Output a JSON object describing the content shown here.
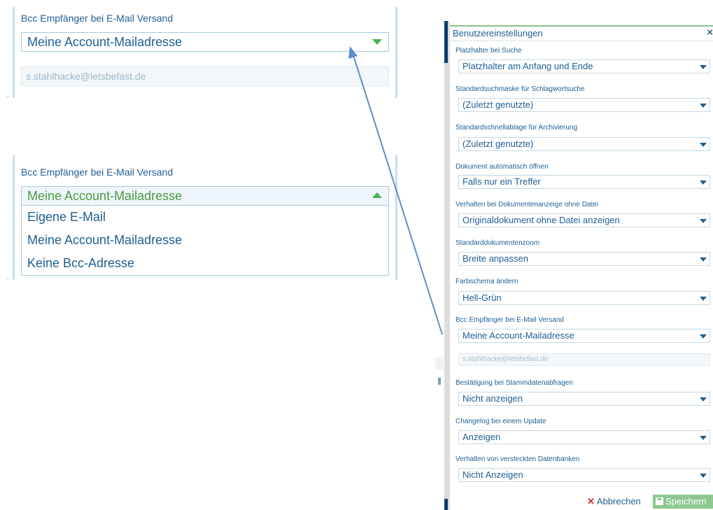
{
  "zoom_closed": {
    "label": "Bcc Empfänger bei E-Mail Versand",
    "selected": "Meine Account-Mailadresse",
    "email": "s.stahlhacke@letsbefast.de"
  },
  "zoom_open": {
    "label": "Bcc Empfänger bei E-Mail Versand",
    "selected": "Meine Account-Mailadresse",
    "options": [
      "Eigene E-Mail",
      "Meine Account-Mailadresse",
      "Keine Bcc-Adresse"
    ]
  },
  "dialog": {
    "title": "Benutzereinstellungen",
    "close_symbol": "×",
    "fields": [
      {
        "label": "Platzhalter bei Suche",
        "value": "Platzhalter am Anfang und Ende"
      },
      {
        "label": "Standardsuchmaske für Schlagwortsuche",
        "value": "(Zuletzt genutzte)"
      },
      {
        "label": "Standardschnellablage für Archivierung",
        "value": "(Zuletzt genutzte)"
      },
      {
        "label": "Dokument automatisch öffnen",
        "value": "Falls nur ein Treffer"
      },
      {
        "label": "Verhalten bei Dokumentenanzeige ohne Datei",
        "value": "Originaldokument ohne Datei anzeigen"
      },
      {
        "label": "Standarddokumentenzoom",
        "value": "Breite anpassen"
      },
      {
        "label": "Farbschema ändern",
        "value": "Hell-Grün"
      },
      {
        "label": "Bcc Empfänger bei E-Mail Versand",
        "value": "Meine Account-Mailadresse"
      },
      {
        "label": "Bestätigung bei Stammdatenabfragen",
        "value": "Nicht anzeigen"
      },
      {
        "label": "Changelog bei einem Update",
        "value": "Anzeigen"
      },
      {
        "label": "Verhalten von versteckten Datenbanken",
        "value": "Nicht Anzeigen"
      }
    ],
    "bcc_email": "s.stahlhacke@letsbefast.de",
    "cancel_label": "Abbrechen",
    "save_label": "Speichern"
  },
  "colors": {
    "accent_green": "#4caf50",
    "text_blue": "#1f5e93",
    "save_green": "#8cc88f",
    "cancel_red": "#d0302a",
    "connector": "#5b8fc8"
  }
}
